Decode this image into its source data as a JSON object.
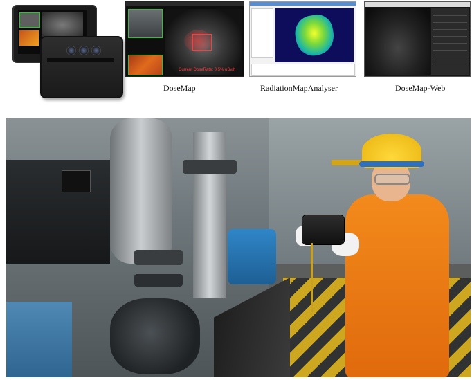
{
  "captions": {
    "panel_2": "DoseMap",
    "panel_3": "RadiationMapAnalyser",
    "panel_4": "DoseMap-Web"
  },
  "dosemap_overlay": "Current DoseRate: 0.5% uSv/h",
  "colors": {
    "accent_green": "#2ec431",
    "dose_red": "#ff3b3b",
    "suit_orange": "#f07a12",
    "helmet_yellow": "#f5c518",
    "floor_stripe_yellow": "#e2b417"
  },
  "icons": [
    "camera-lens-icon"
  ]
}
